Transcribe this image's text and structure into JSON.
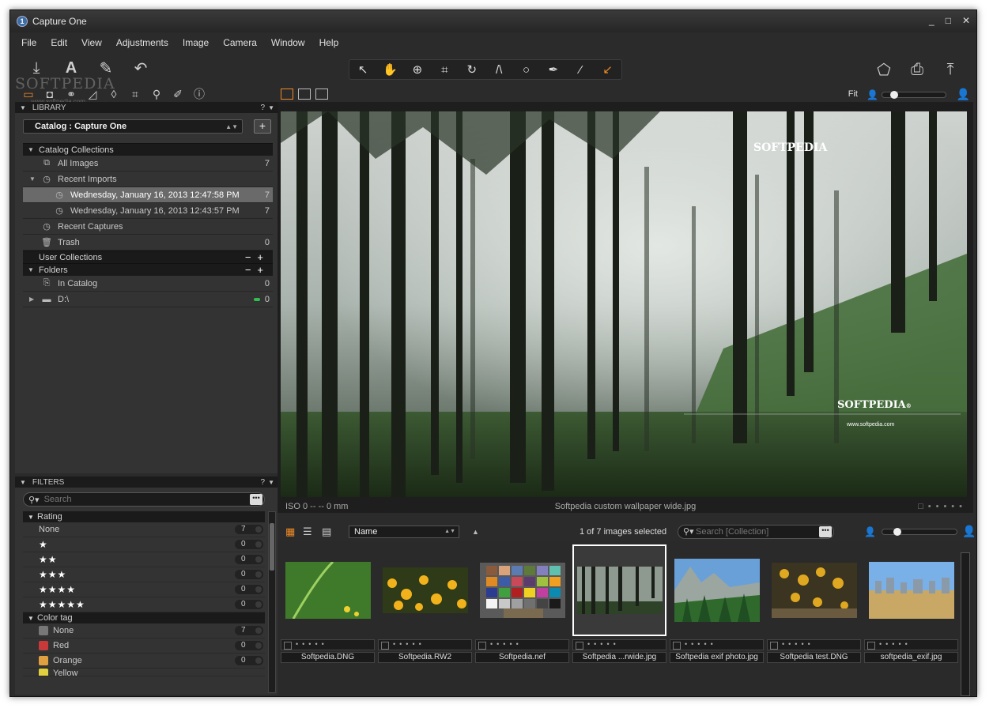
{
  "window": {
    "title": "Capture One",
    "controls": [
      "_",
      "□",
      "✕"
    ]
  },
  "menu": [
    "File",
    "Edit",
    "View",
    "Adjustments",
    "Image",
    "Camera",
    "Window",
    "Help"
  ],
  "watermark": {
    "text": "SOFTPEDIA",
    "url": "www.softpedia.com"
  },
  "library": {
    "header": "LIBRARY",
    "help": "?",
    "catalog_label": "Catalog : Capture One",
    "catalog_collections": "Catalog Collections",
    "all_images": {
      "label": "All Images",
      "count": "7"
    },
    "recent_imports": "Recent Imports",
    "imports": [
      {
        "label": "Wednesday, January 16, 2013 12:47:58 PM",
        "count": "7"
      },
      {
        "label": "Wednesday, January 16, 2013 12:43:57 PM",
        "count": "7"
      }
    ],
    "recent_captures": "Recent Captures",
    "trash": {
      "label": "Trash",
      "count": "0"
    },
    "user_collections": "User Collections",
    "folders": "Folders",
    "in_catalog": {
      "label": "In Catalog",
      "count": "0"
    },
    "drive": {
      "label": "D:\\",
      "count": "0"
    }
  },
  "filters": {
    "header": "FILTERS",
    "help": "?",
    "search_placeholder": "Search",
    "rating_title": "Rating",
    "ratings": [
      {
        "label": "None",
        "count": "7"
      },
      {
        "label": "★",
        "count": "0"
      },
      {
        "label": "★★",
        "count": "0"
      },
      {
        "label": "★★★",
        "count": "0"
      },
      {
        "label": "★★★★",
        "count": "0"
      },
      {
        "label": "★★★★★",
        "count": "0"
      }
    ],
    "color_title": "Color tag",
    "colors": [
      {
        "label": "None",
        "count": "7",
        "color": "#777777"
      },
      {
        "label": "Red",
        "count": "0",
        "color": "#c83a3a"
      },
      {
        "label": "Orange",
        "count": "0",
        "color": "#e0a040"
      },
      {
        "label": "Yellow",
        "count": "",
        "color": "#e0d040"
      }
    ]
  },
  "viewer": {
    "zoom": "Fit",
    "iso": "ISO 0 -- -- 0 mm",
    "filename": "Softpedia custom wallpaper wide.jpg",
    "overlay_brand": "SOFTPEDIA",
    "overlay_brand2": "SOFTPEDIA",
    "overlay_brand2_mark": "®",
    "overlay_url": "www.softpedia.com"
  },
  "browser": {
    "sort": "Name",
    "selection": "1 of 7 images selected",
    "search_placeholder": "Search [Collection]",
    "thumbs": [
      {
        "name": "Softpedia.DNG"
      },
      {
        "name": "Softpedia.RW2"
      },
      {
        "name": "Softpedia.nef"
      },
      {
        "name": "Softpedia ...rwide.jpg"
      },
      {
        "name": "Softpedia exif photo.jpg"
      },
      {
        "name": "Softpedia test.DNG"
      },
      {
        "name": "softpedia_exif.jpg"
      }
    ]
  },
  "colors": {
    "accent": "#f08a24",
    "panel": "#333333",
    "background": "#2b2b2b"
  }
}
